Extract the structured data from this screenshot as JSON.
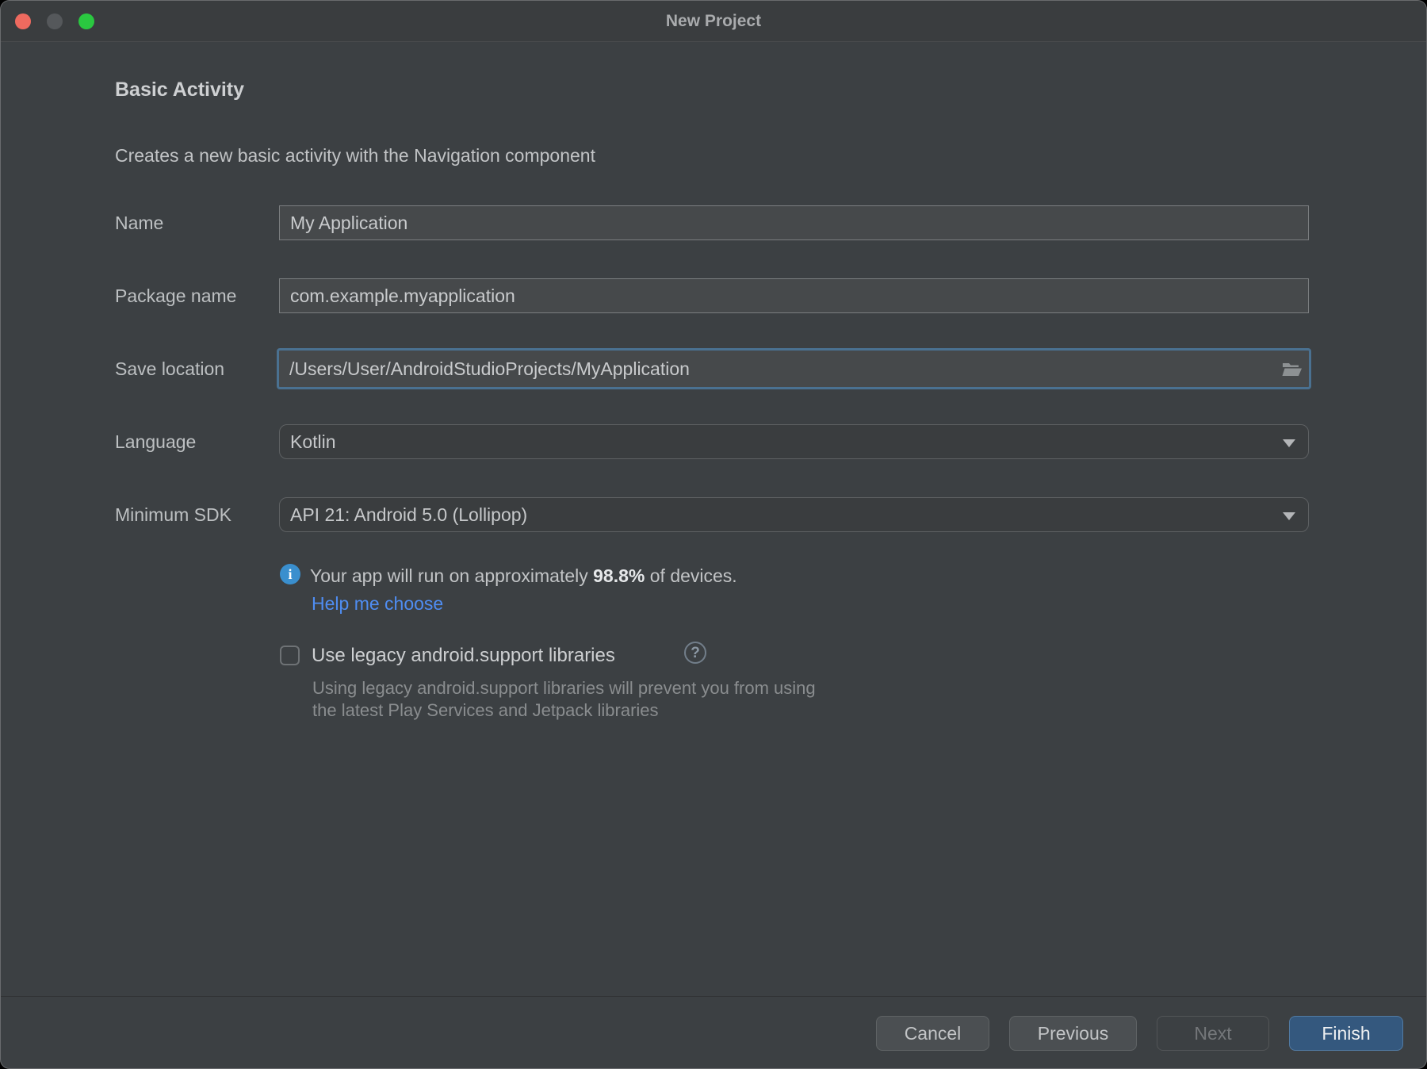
{
  "window": {
    "title": "New Project"
  },
  "header": {
    "title": "Basic Activity",
    "subtitle": "Creates a new basic activity with the Navigation component"
  },
  "form": {
    "name": {
      "label": "Name",
      "value": "My Application"
    },
    "package": {
      "label": "Package name",
      "value": "com.example.myapplication"
    },
    "location": {
      "label": "Save location",
      "value": "/Users/User/AndroidStudioProjects/MyApplication",
      "icon": "folder-open-icon"
    },
    "language": {
      "label": "Language",
      "value": "Kotlin",
      "icon": "chevron-down-icon"
    },
    "min_sdk": {
      "label": "Minimum SDK",
      "value": "API 21: Android 5.0 (Lollipop)",
      "icon": "chevron-down-icon"
    },
    "sdk_info": {
      "icon_glyph": "i",
      "prefix": "Your app will run on approximately ",
      "percent": "98.8%",
      "suffix": " of devices.",
      "link": "Help me choose"
    },
    "legacy": {
      "label": "Use legacy android.support libraries",
      "checked": false,
      "help_glyph": "?",
      "description_line1": "Using legacy android.support libraries will prevent you from using",
      "description_line2": "the latest Play Services and Jetpack libraries"
    }
  },
  "footer": {
    "cancel": "Cancel",
    "previous": "Previous",
    "next": "Next",
    "finish": "Finish"
  },
  "colors": {
    "dialog_bg": "#3c4043",
    "titlebar_bg": "#3a3d3f",
    "field_bg": "#46494b",
    "focus_border": "#4a7191",
    "link": "#4f8df2",
    "info_icon": "#3a8fce",
    "primary_button": "#34587e",
    "traffic_close": "#ee6a5f",
    "traffic_minimize": "#55585b",
    "traffic_zoom": "#2ac840"
  }
}
